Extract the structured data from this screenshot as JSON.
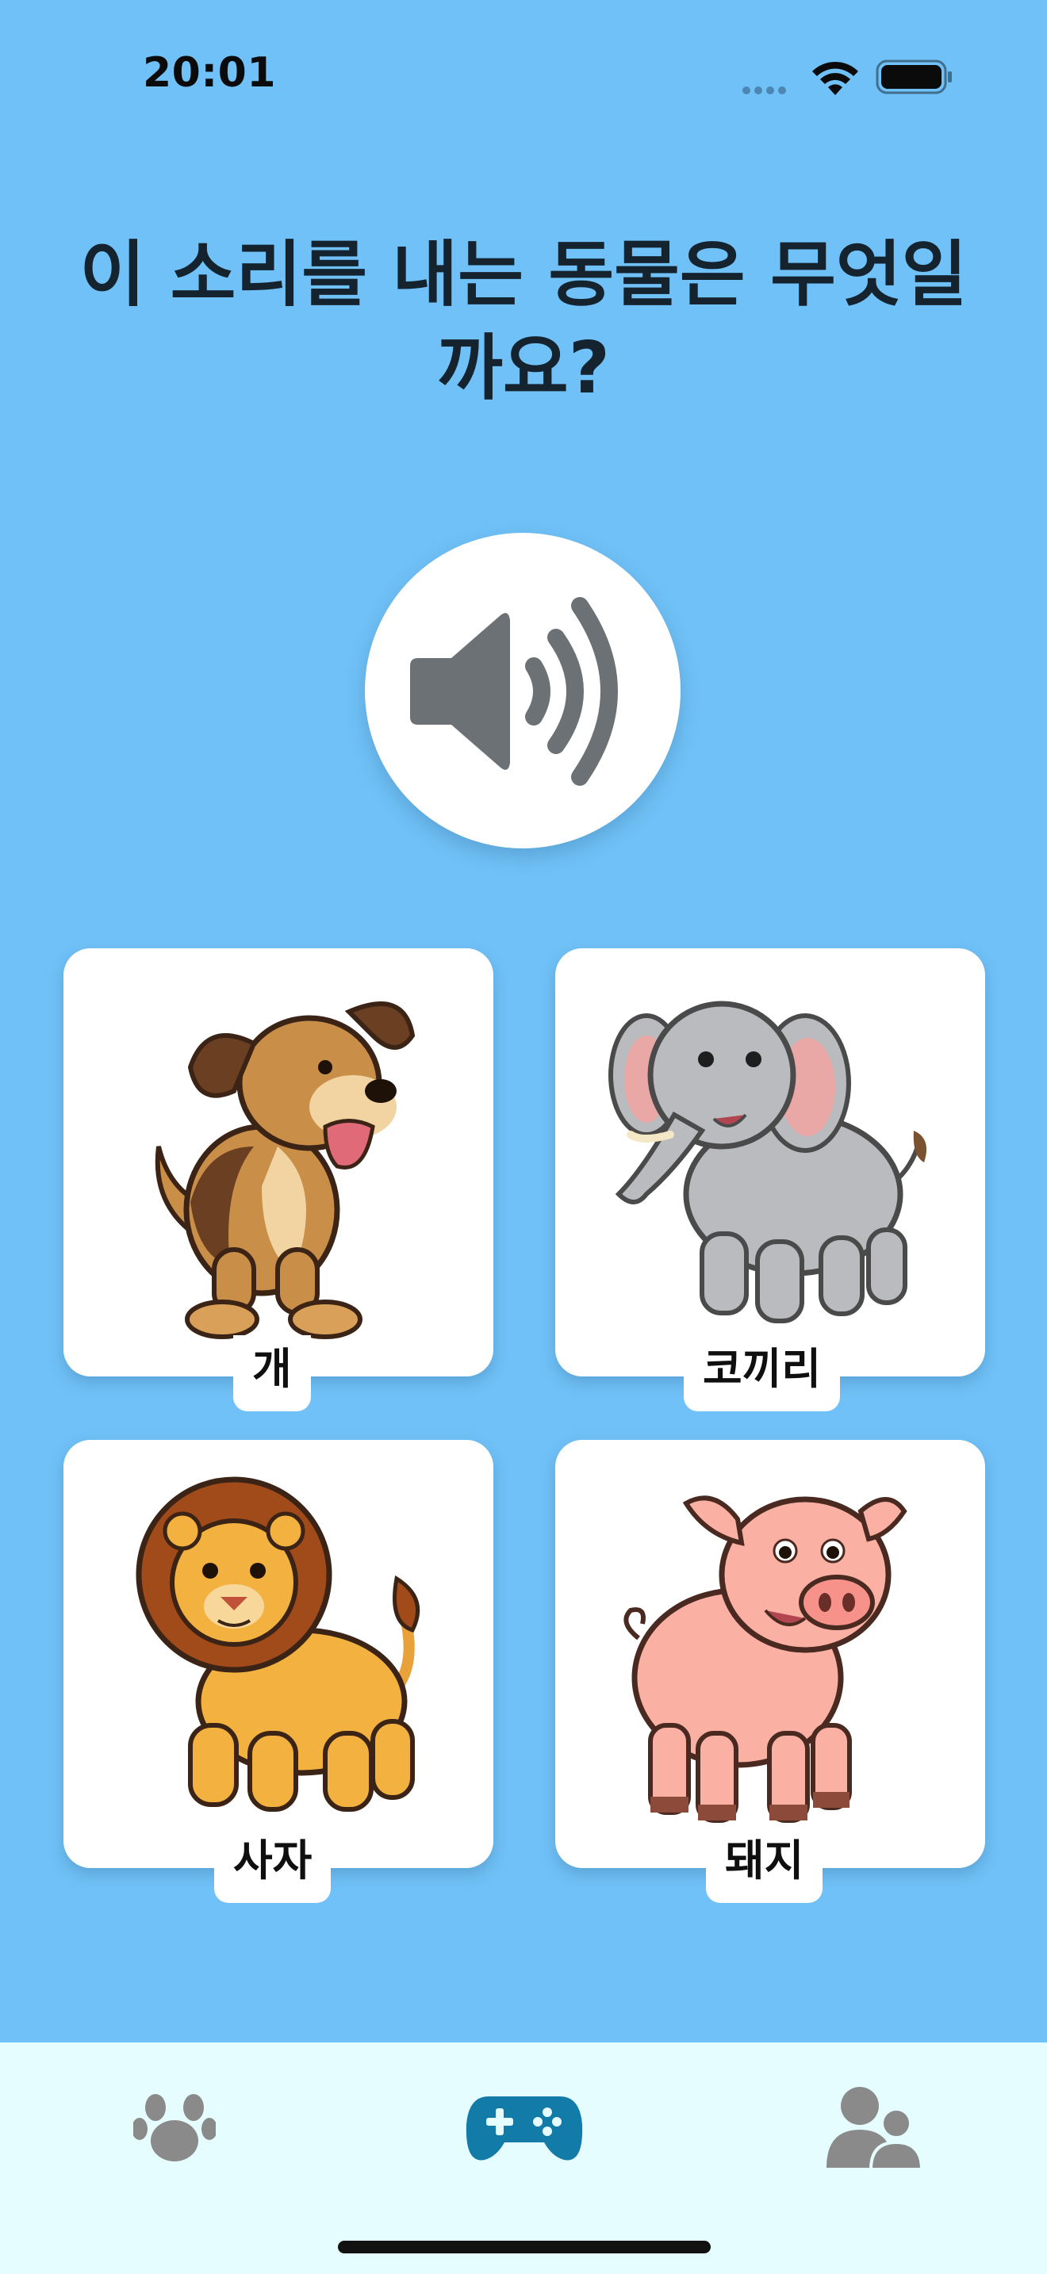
{
  "status_bar": {
    "time": "20:01"
  },
  "question": {
    "line1": "이 소리를 내는 동물은 무엇일",
    "line2": "까요?"
  },
  "speaker": {
    "icon": "speaker-volume-icon"
  },
  "answers": [
    {
      "label": "개",
      "icon": "dog-illustration"
    },
    {
      "label": "코끼리",
      "icon": "elephant-illustration"
    },
    {
      "label": "사자",
      "icon": "lion-illustration"
    },
    {
      "label": "돼지",
      "icon": "pig-illustration"
    }
  ],
  "tab_bar": {
    "tabs": [
      {
        "icon": "paw-icon",
        "selected": false
      },
      {
        "icon": "gamepad-icon",
        "selected": true
      },
      {
        "icon": "users-icon",
        "selected": false
      }
    ],
    "colors": {
      "selected": "#127BA8",
      "unselected": "#8A8A8A",
      "background": "#E6FDFF"
    }
  },
  "colors": {
    "background": "#70C1F7",
    "card": "#FFFFFF",
    "speaker_icon": "#6C7176"
  }
}
